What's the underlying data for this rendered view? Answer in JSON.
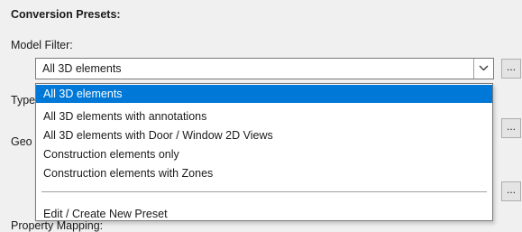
{
  "section_title": "Conversion Presets:",
  "labels": {
    "model_filter": "Model Filter:",
    "type_partial": "Type",
    "geometry_partial": "Geo",
    "property_mapping": "Property Mapping:"
  },
  "model_filter": {
    "selected_value": "All 3D elements",
    "options": [
      "All 3D elements",
      "All 3D elements with annotations",
      "All 3D elements with Door / Window 2D Views",
      "Construction elements only",
      "Construction elements with Zones"
    ],
    "footer_option": "Edit / Create New Preset"
  },
  "buttons": {
    "more_label": "..."
  },
  "icons": {
    "combo_arrow": "chevron-down-icon"
  },
  "colors": {
    "selection": "#0078d7",
    "background": "#f0f0f0"
  }
}
